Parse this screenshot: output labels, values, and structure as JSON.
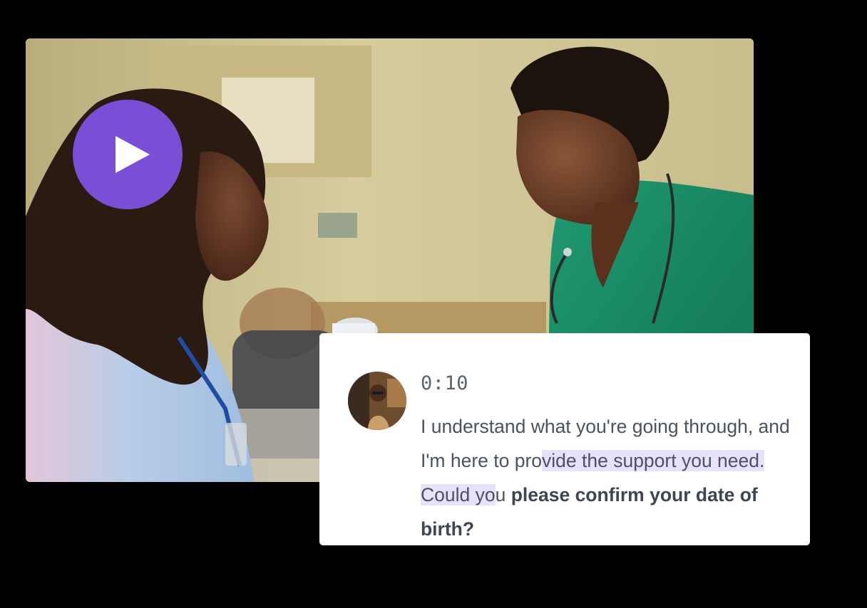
{
  "video": {
    "play_button": {
      "icon": "play-icon",
      "accent_color": "#7b4ed6"
    }
  },
  "transcript_card": {
    "avatar": "speaker-avatar",
    "timestamp": "0:10",
    "text_plain": "I understand what you're going through, and I'm here to pro",
    "text_highlighted": "vide the support you need. Could yo",
    "text_after_highlight": "u ",
    "text_bold": "please confirm your date of birth?",
    "highlight_color": "#e9e0fb"
  }
}
